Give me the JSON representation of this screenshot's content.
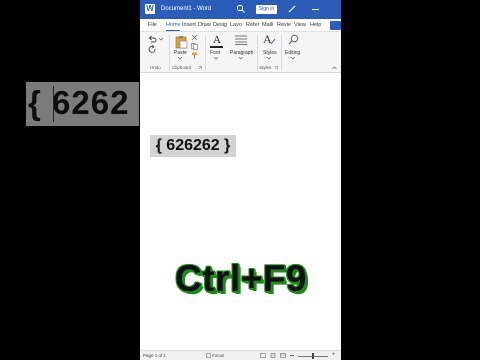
{
  "backdrop": {
    "zoom_text": "{ 6262"
  },
  "titlebar": {
    "doc_title": "Document1  -  Word",
    "signin_label": "Sign in"
  },
  "tabs": [
    {
      "label": "File"
    },
    {
      "label": "Home"
    },
    {
      "label": "Insert"
    },
    {
      "label": "Draw"
    },
    {
      "label": "Desig"
    },
    {
      "label": "Layo"
    },
    {
      "label": "Refer"
    },
    {
      "label": "Maili"
    },
    {
      "label": "Revie"
    },
    {
      "label": "View"
    },
    {
      "label": "Help"
    }
  ],
  "active_tab": "Home",
  "ribbon": {
    "undo_group": "Undo",
    "paste_label": "Paste",
    "clipboard_group": "Clipboard",
    "font_label": "Font",
    "paragraph_label": "Paragraph",
    "styles_label": "Styles",
    "styles_group": "Styles",
    "editing_label": "Editing"
  },
  "document": {
    "field_text": "{ 626262 }",
    "overlay_shortcut": "Ctrl+F9"
  },
  "statusbar": {
    "page_info": "Page 1 of 1",
    "focus_label": "Focus"
  },
  "colors": {
    "accent": "#2b5cb8",
    "field_shading": "#d3d3d3",
    "shortcut_outline": "#1f8a1f"
  }
}
